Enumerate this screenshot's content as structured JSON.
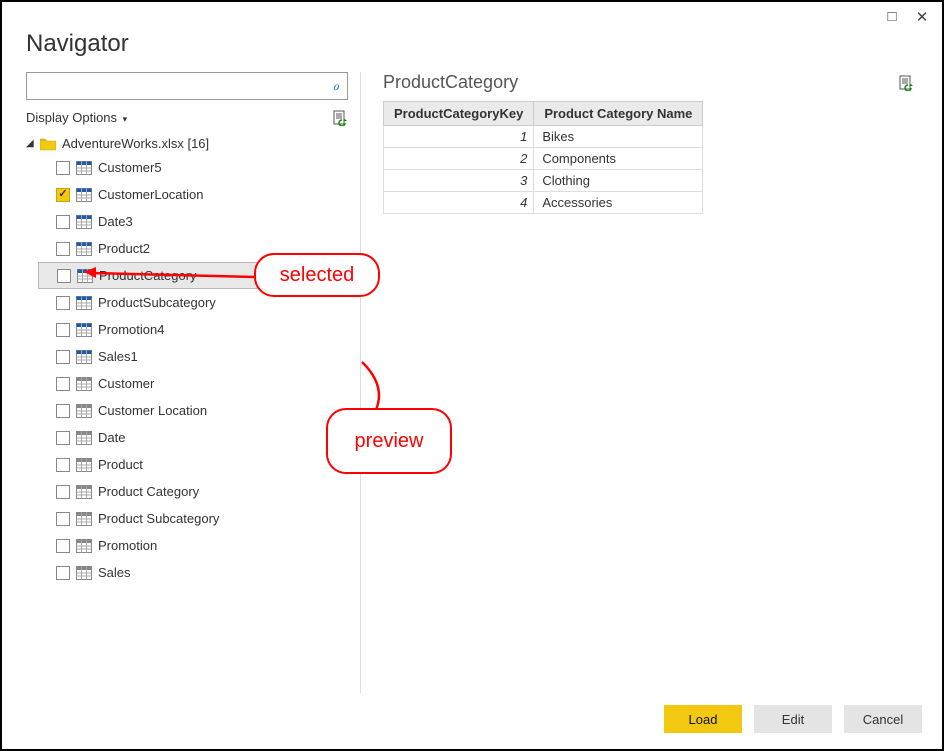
{
  "window": {
    "title": "Navigator"
  },
  "search": {
    "placeholder": ""
  },
  "options": {
    "display_label": "Display Options"
  },
  "tree": {
    "root_label": "AdventureWorks.xlsx [16]",
    "items": [
      {
        "label": "Customer5",
        "checked": false,
        "blue": true,
        "highlighted": false
      },
      {
        "label": "CustomerLocation",
        "checked": true,
        "blue": true,
        "highlighted": false
      },
      {
        "label": "Date3",
        "checked": false,
        "blue": true,
        "highlighted": false
      },
      {
        "label": "Product2",
        "checked": false,
        "blue": true,
        "highlighted": false
      },
      {
        "label": "ProductCategory",
        "checked": false,
        "blue": true,
        "highlighted": true
      },
      {
        "label": "ProductSubcategory",
        "checked": false,
        "blue": true,
        "highlighted": false
      },
      {
        "label": "Promotion4",
        "checked": false,
        "blue": true,
        "highlighted": false
      },
      {
        "label": "Sales1",
        "checked": false,
        "blue": true,
        "highlighted": false
      },
      {
        "label": "Customer",
        "checked": false,
        "blue": false,
        "highlighted": false
      },
      {
        "label": "Customer Location",
        "checked": false,
        "blue": false,
        "highlighted": false
      },
      {
        "label": "Date",
        "checked": false,
        "blue": false,
        "highlighted": false
      },
      {
        "label": "Product",
        "checked": false,
        "blue": false,
        "highlighted": false
      },
      {
        "label": "Product Category",
        "checked": false,
        "blue": false,
        "highlighted": false
      },
      {
        "label": "Product Subcategory",
        "checked": false,
        "blue": false,
        "highlighted": false
      },
      {
        "label": "Promotion",
        "checked": false,
        "blue": false,
        "highlighted": false
      },
      {
        "label": "Sales",
        "checked": false,
        "blue": false,
        "highlighted": false
      }
    ]
  },
  "preview": {
    "title": "ProductCategory",
    "columns": [
      "ProductCategoryKey",
      "Product Category Name"
    ],
    "rows": [
      {
        "key": "1",
        "name": "Bikes"
      },
      {
        "key": "2",
        "name": "Components"
      },
      {
        "key": "3",
        "name": "Clothing"
      },
      {
        "key": "4",
        "name": "Accessories"
      }
    ]
  },
  "footer": {
    "load": "Load",
    "edit": "Edit",
    "cancel": "Cancel"
  },
  "annotations": {
    "selected": "selected",
    "preview": "preview"
  }
}
